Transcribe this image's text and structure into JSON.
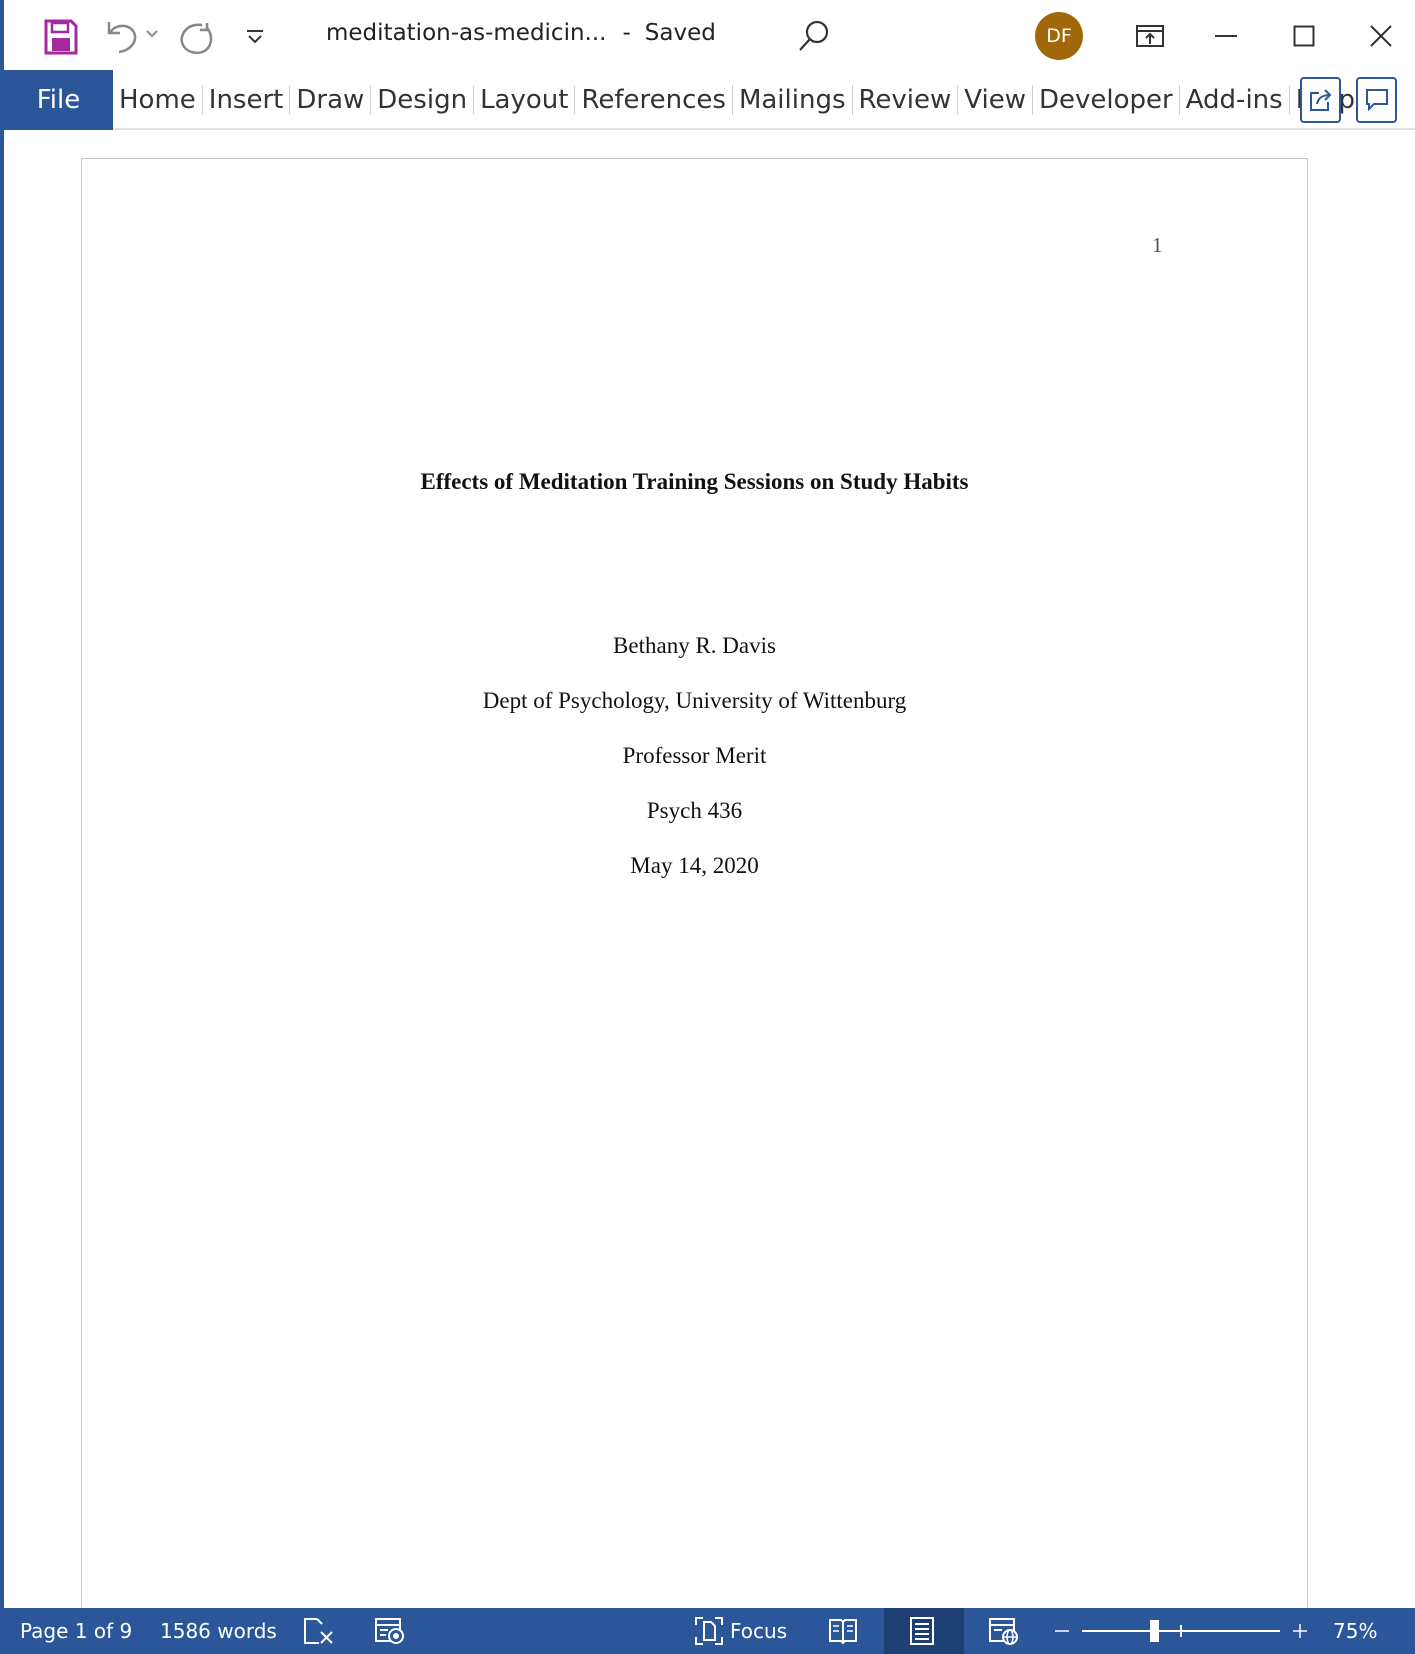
{
  "titlebar": {
    "doc_name": "meditation-as-medicin...",
    "separator": "-",
    "save_status": "Saved",
    "avatar_initials": "DF"
  },
  "ribbon": {
    "file_label": "File",
    "tabs": [
      "Home",
      "Insert",
      "Draw",
      "Design",
      "Layout",
      "References",
      "Mailings",
      "Review",
      "View",
      "Developer",
      "Add-ins",
      "Help"
    ]
  },
  "document": {
    "page_number": "1",
    "title": "Effects of Meditation Training Sessions on Study Habits",
    "author": "Bethany R. Davis",
    "affiliation": "Dept of Psychology, University of Wittenburg",
    "instructor": "Professor Merit",
    "course": "Psych 436",
    "date": "May 14, 2020"
  },
  "statusbar": {
    "page_info": "Page 1 of 9",
    "word_count": "1586 words",
    "focus_label": "Focus",
    "zoom_level": "75%",
    "zoom_fraction": 0.75
  },
  "colors": {
    "accent": "#2b579a",
    "save_icon": "#a4289e",
    "avatar": "#a0680a"
  }
}
